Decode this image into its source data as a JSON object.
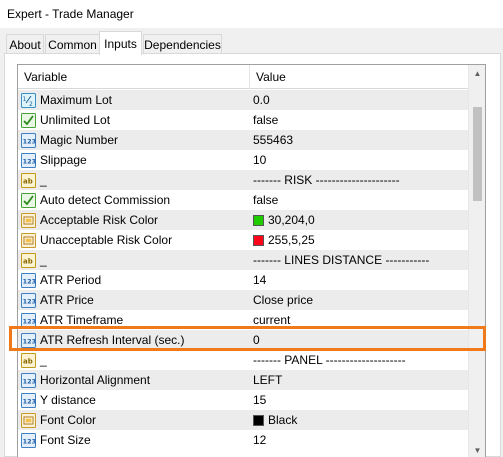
{
  "window": {
    "title": "Expert - Trade Manager"
  },
  "tabs": [
    {
      "label": "About"
    },
    {
      "label": "Common"
    },
    {
      "label": "Inputs"
    },
    {
      "label": "Dependencies"
    }
  ],
  "grid": {
    "col_variable": "Variable",
    "col_value": "Value",
    "rows": [
      {
        "icon": "double-icon",
        "variable": "Maximum Lot",
        "value": "0.0"
      },
      {
        "icon": "bool-icon",
        "variable": "Unlimited Lot",
        "value": "false"
      },
      {
        "icon": "int-icon",
        "variable": "Magic Number",
        "value": "555463"
      },
      {
        "icon": "int-icon",
        "variable": "Slippage",
        "value": "10"
      },
      {
        "icon": "string-icon",
        "variable": "_",
        "value": "------- RISK ---------------------"
      },
      {
        "icon": "bool-icon",
        "variable": "Auto detect Commission",
        "value": "false"
      },
      {
        "icon": "color-icon",
        "variable": "Acceptable Risk Color",
        "value": "30,204,0",
        "swatch": "#1ecc00"
      },
      {
        "icon": "color-icon",
        "variable": "Unacceptable Risk Color",
        "value": "255,5,25",
        "swatch": "#ff0519"
      },
      {
        "icon": "string-icon",
        "variable": "_",
        "value": "------- LINES DISTANCE -----------"
      },
      {
        "icon": "int-icon",
        "variable": "ATR Period",
        "value": "14"
      },
      {
        "icon": "enum-icon",
        "variable": "ATR Price",
        "value": "Close price"
      },
      {
        "icon": "enum-icon",
        "variable": "ATR Timeframe",
        "value": "current"
      },
      {
        "icon": "int-icon",
        "variable": "ATR Refresh Interval (sec.)",
        "value": "0"
      },
      {
        "icon": "string-icon",
        "variable": "_",
        "value": "------- PANEL --------------------"
      },
      {
        "icon": "enum-icon",
        "variable": "Horizontal Alignment",
        "value": "LEFT"
      },
      {
        "icon": "int-icon",
        "variable": "Y distance",
        "value": "15"
      },
      {
        "icon": "color-icon",
        "variable": "Font Color",
        "value": "Black",
        "swatch": "#000000"
      },
      {
        "icon": "int-icon",
        "variable": "Font Size",
        "value": "12"
      }
    ]
  },
  "highlight_color": "#f07a1a"
}
